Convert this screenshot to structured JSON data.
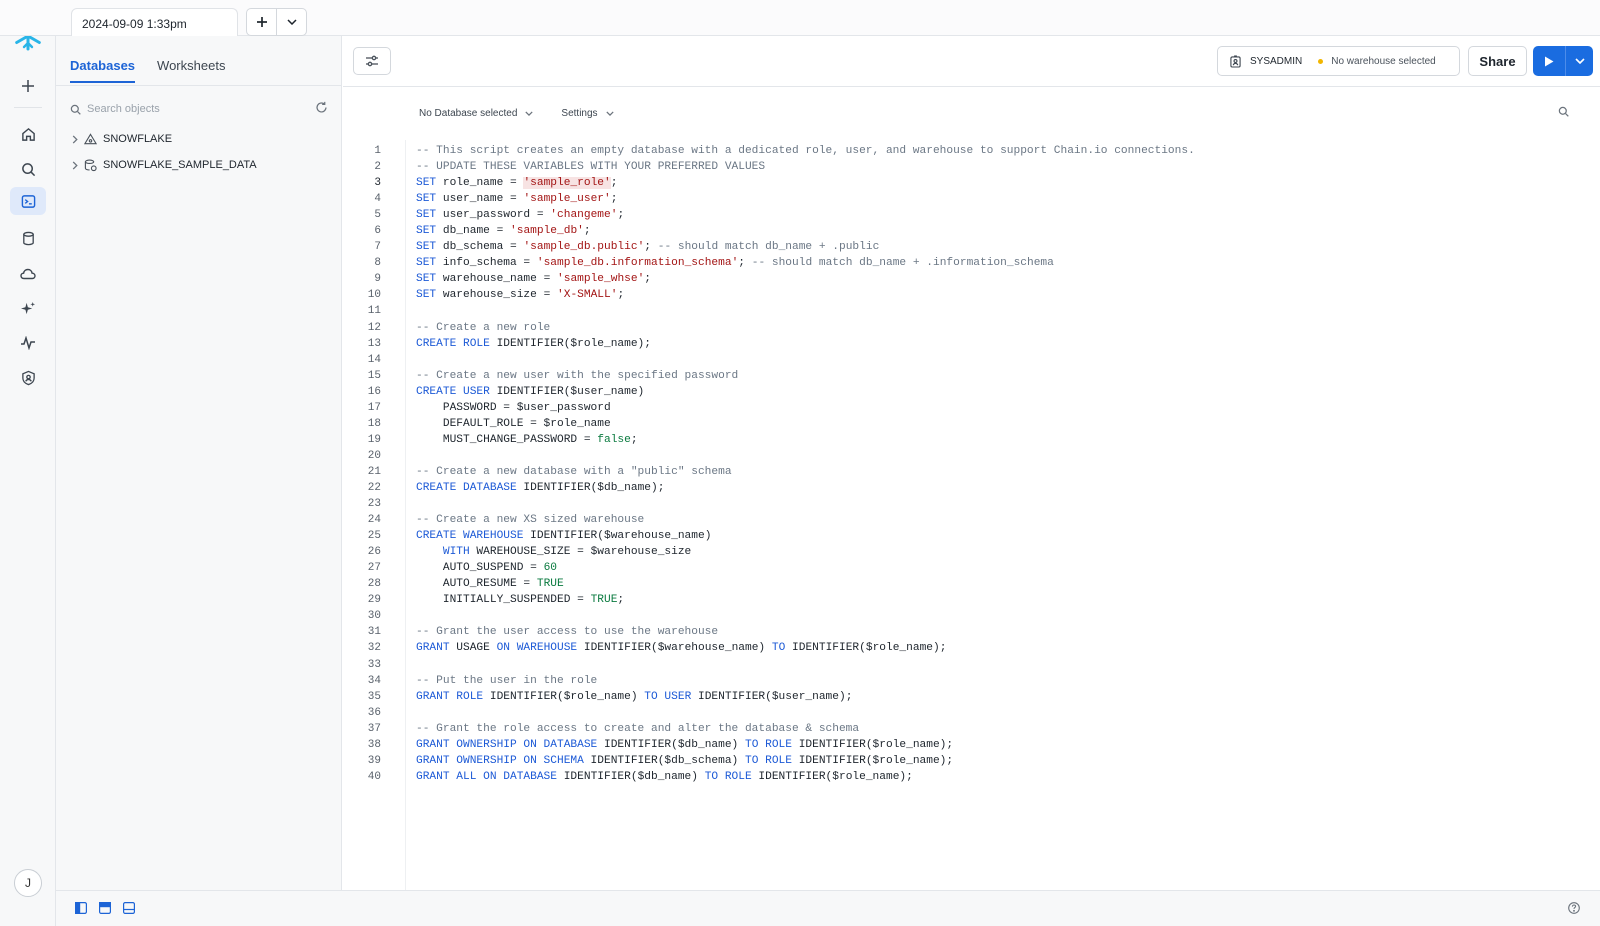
{
  "tab": {
    "title": "2024-09-09 1:33pm"
  },
  "sidebar": {
    "tabs": [
      "Databases",
      "Worksheets"
    ],
    "search_placeholder": "Search objects",
    "tree": [
      "SNOWFLAKE",
      "SNOWFLAKE_SAMPLE_DATA"
    ]
  },
  "toolbar": {
    "role": "SYSADMIN",
    "warehouse": "No warehouse selected",
    "share_label": "Share"
  },
  "subbar": {
    "database": "No Database selected",
    "settings": "Settings"
  },
  "user": {
    "initial": "J"
  },
  "colors": {
    "accent": "#1d64d6",
    "run": "#1a6ce0",
    "warehouse_dot": "#f2b600",
    "logo": "#29b5e8"
  },
  "editor": {
    "current_line": 3,
    "lines": [
      [
        [
          "c",
          "-- This script creates an empty database with a dedicated role, user, and warehouse to support Chain.io connections."
        ]
      ],
      [
        [
          "c",
          "-- UPDATE THESE VARIABLES WITH YOUR PREFERRED VALUES"
        ]
      ],
      [
        [
          "k",
          "SET"
        ],
        [
          "t",
          " role_name = "
        ],
        [
          "h",
          "'sample_role'"
        ],
        [
          "t",
          ";"
        ]
      ],
      [
        [
          "k",
          "SET"
        ],
        [
          "t",
          " user_name = "
        ],
        [
          "s",
          "'sample_user'"
        ],
        [
          "t",
          ";"
        ]
      ],
      [
        [
          "k",
          "SET"
        ],
        [
          "t",
          " user_password = "
        ],
        [
          "s",
          "'changeme'"
        ],
        [
          "t",
          ";"
        ]
      ],
      [
        [
          "k",
          "SET"
        ],
        [
          "t",
          " db_name = "
        ],
        [
          "s",
          "'sample_db'"
        ],
        [
          "t",
          ";"
        ]
      ],
      [
        [
          "k",
          "SET"
        ],
        [
          "t",
          " db_schema = "
        ],
        [
          "s",
          "'sample_db.public'"
        ],
        [
          "t",
          "; "
        ],
        [
          "c",
          "-- should match db_name + .public"
        ]
      ],
      [
        [
          "k",
          "SET"
        ],
        [
          "t",
          " info_schema = "
        ],
        [
          "s",
          "'sample_db.information_schema'"
        ],
        [
          "t",
          "; "
        ],
        [
          "c",
          "-- should match db_name + .information_schema"
        ]
      ],
      [
        [
          "k",
          "SET"
        ],
        [
          "t",
          " warehouse_name = "
        ],
        [
          "s",
          "'sample_whse'"
        ],
        [
          "t",
          ";"
        ]
      ],
      [
        [
          "k",
          "SET"
        ],
        [
          "t",
          " warehouse_size = "
        ],
        [
          "s",
          "'X-SMALL'"
        ],
        [
          "t",
          ";"
        ]
      ],
      [],
      [
        [
          "c",
          "-- Create a new role"
        ]
      ],
      [
        [
          "k",
          "CREATE ROLE"
        ],
        [
          "t",
          " IDENTIFIER($role_name);"
        ]
      ],
      [],
      [
        [
          "c",
          "-- Create a new user with the specified password"
        ]
      ],
      [
        [
          "k",
          "CREATE USER"
        ],
        [
          "t",
          " IDENTIFIER($user_name)"
        ]
      ],
      [
        [
          "t",
          "    PASSWORD = $user_password"
        ]
      ],
      [
        [
          "t",
          "    DEFAULT_ROLE = $role_name"
        ]
      ],
      [
        [
          "t",
          "    MUST_CHANGE_PASSWORD = "
        ],
        [
          "n",
          "false"
        ],
        [
          "t",
          ";"
        ]
      ],
      [],
      [
        [
          "c",
          "-- Create a new database with a \"public\" schema"
        ]
      ],
      [
        [
          "k",
          "CREATE DATABASE"
        ],
        [
          "t",
          " IDENTIFIER($db_name);"
        ]
      ],
      [],
      [
        [
          "c",
          "-- Create a new XS sized warehouse"
        ]
      ],
      [
        [
          "k",
          "CREATE WAREHOUSE"
        ],
        [
          "t",
          " IDENTIFIER($warehouse_name)"
        ]
      ],
      [
        [
          "t",
          "    "
        ],
        [
          "k",
          "WITH"
        ],
        [
          "t",
          " WAREHOUSE_SIZE = $warehouse_size"
        ]
      ],
      [
        [
          "t",
          "    AUTO_SUSPEND = "
        ],
        [
          "n",
          "60"
        ]
      ],
      [
        [
          "t",
          "    AUTO_RESUME = "
        ],
        [
          "n",
          "TRUE"
        ]
      ],
      [
        [
          "t",
          "    INITIALLY_SUSPENDED = "
        ],
        [
          "n",
          "TRUE"
        ],
        [
          "t",
          ";"
        ]
      ],
      [],
      [
        [
          "c",
          "-- Grant the user access to use the warehouse"
        ]
      ],
      [
        [
          "k",
          "GRANT"
        ],
        [
          "t",
          " USAGE "
        ],
        [
          "k",
          "ON WAREHOUSE"
        ],
        [
          "t",
          " IDENTIFIER($warehouse_name) "
        ],
        [
          "k",
          "TO"
        ],
        [
          "t",
          " IDENTIFIER($role_name);"
        ]
      ],
      [],
      [
        [
          "c",
          "-- Put the user in the role"
        ]
      ],
      [
        [
          "k",
          "GRANT ROLE"
        ],
        [
          "t",
          " IDENTIFIER($role_name) "
        ],
        [
          "k",
          "TO USER"
        ],
        [
          "t",
          " IDENTIFIER($user_name);"
        ]
      ],
      [],
      [
        [
          "c",
          "-- Grant the role access to create and alter the database & schema"
        ]
      ],
      [
        [
          "k",
          "GRANT OWNERSHIP ON DATABASE"
        ],
        [
          "t",
          " IDENTIFIER($db_name) "
        ],
        [
          "k",
          "TO ROLE"
        ],
        [
          "t",
          " IDENTIFIER($role_name);"
        ]
      ],
      [
        [
          "k",
          "GRANT OWNERSHIP ON SCHEMA"
        ],
        [
          "t",
          " IDENTIFIER($db_schema) "
        ],
        [
          "k",
          "TO ROLE"
        ],
        [
          "t",
          " IDENTIFIER($role_name);"
        ]
      ],
      [
        [
          "k",
          "GRANT ALL ON DATABASE"
        ],
        [
          "t",
          " IDENTIFIER($db_name) "
        ],
        [
          "k",
          "TO ROLE"
        ],
        [
          "t",
          " IDENTIFIER($role_name);"
        ]
      ]
    ]
  }
}
